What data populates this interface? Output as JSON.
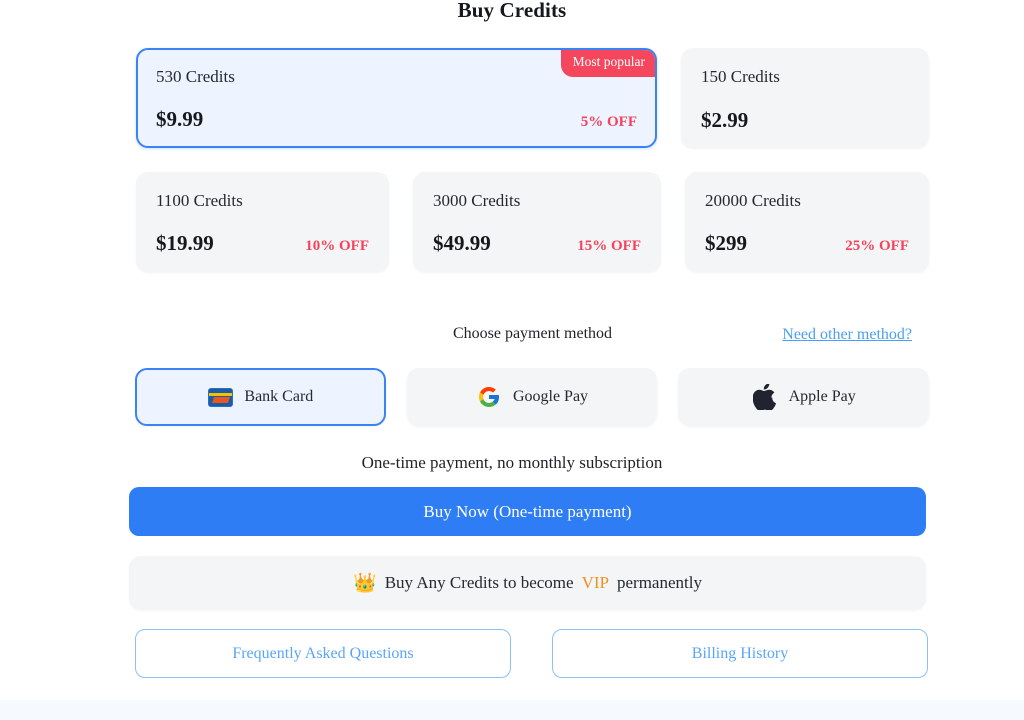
{
  "page": {
    "title": "Buy Credits"
  },
  "packages": {
    "row1": [
      {
        "credits": "530 Credits",
        "price": "$9.99",
        "discount": "5% OFF",
        "badge": "Most popular",
        "selected": true
      },
      {
        "credits": "150 Credits",
        "price": "$2.99",
        "discount": "",
        "badge": "",
        "selected": false
      }
    ],
    "row2": [
      {
        "credits": "1100 Credits",
        "price": "$19.99",
        "discount": "10% OFF",
        "badge": "",
        "selected": false
      },
      {
        "credits": "3000 Credits",
        "price": "$49.99",
        "discount": "15% OFF",
        "badge": "",
        "selected": false
      },
      {
        "credits": "20000 Credits",
        "price": "$299",
        "discount": "25% OFF",
        "badge": "",
        "selected": false
      }
    ]
  },
  "payment": {
    "choose_label": "Choose payment method",
    "other_method_link": "Need other method?",
    "methods": [
      {
        "label": "Bank Card",
        "icon": "bank-card-icon",
        "selected": true
      },
      {
        "label": "Google Pay",
        "icon": "google-logo-icon",
        "selected": false
      },
      {
        "label": "Apple Pay",
        "icon": "apple-logo-icon",
        "selected": false
      }
    ]
  },
  "checkout": {
    "note": "One-time payment, no monthly subscription",
    "buy_button": "Buy Now (One-time payment)"
  },
  "vip_banner": {
    "icon": "crown-icon",
    "crown": "👑",
    "text_before": "Buy Any Credits to become",
    "vip_word": "VIP",
    "text_after": "permanently"
  },
  "footer": {
    "faq_label": "Frequently Asked Questions",
    "billing_label": "Billing History"
  },
  "colors": {
    "accent_blue": "#2f7df4",
    "selected_bg": "#edf3ff",
    "badge_red": "#f4475d",
    "discount_red": "#f4435c",
    "vip_orange": "#f0911f",
    "link_blue": "#4ba0f5",
    "card_bg": "#f4f5f6",
    "bottom_strip": "#f6f9fd"
  }
}
